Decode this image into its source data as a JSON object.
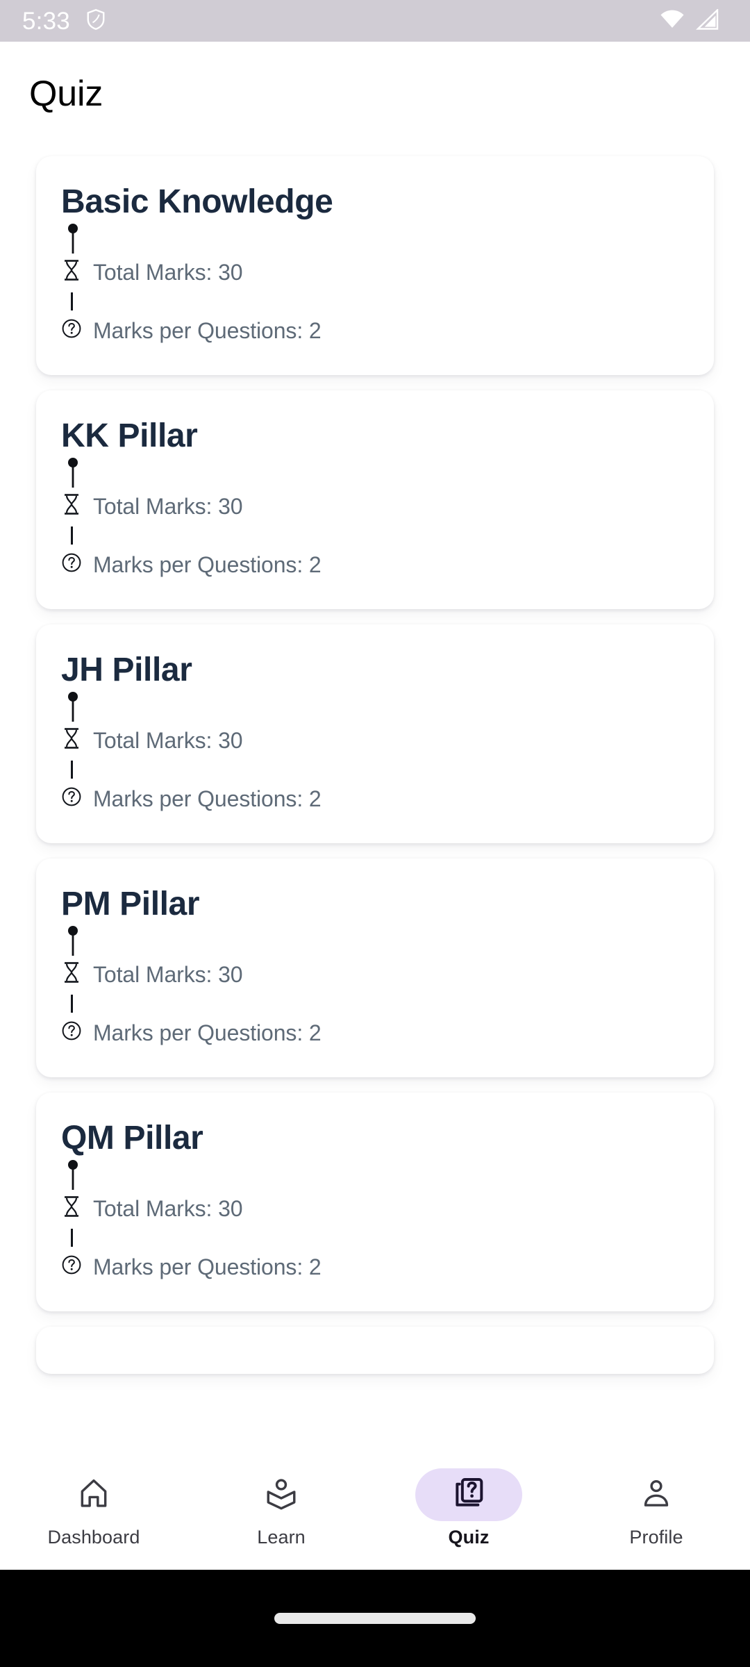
{
  "status_bar": {
    "clock": "5:33",
    "icons": [
      "shield-icon",
      "wifi-icon",
      "cellular-signal-icon"
    ],
    "background_color": "#d0ccd4",
    "foreground_color": "#ffffff"
  },
  "header": {
    "title": "Quiz"
  },
  "theme": {
    "card_background": "#ffffff",
    "card_title_color": "#1b2a3f",
    "meta_text_color": "#5e6a77",
    "active_nav_indicator": "#e7ddf8",
    "page_background": "#ffffff",
    "gesture_bar": "#000000"
  },
  "quiz_list": {
    "labels": {
      "total_marks_prefix": "Total Marks:",
      "marks_per_question_prefix": "Marks per Questions:"
    },
    "glyphs": {
      "pin": "•",
      "hourglass": "⧗",
      "question": "?"
    },
    "items": [
      {
        "title": "Basic Knowledge",
        "total_marks_text": "Total Marks: 30",
        "marks_per_question_text": "Marks per Questions: 2",
        "total_marks": 30,
        "marks_per_question": 2
      },
      {
        "title": "KK Pillar",
        "total_marks_text": "Total Marks: 30",
        "marks_per_question_text": "Marks per Questions: 2",
        "total_marks": 30,
        "marks_per_question": 2
      },
      {
        "title": "JH Pillar",
        "total_marks_text": "Total Marks: 30",
        "marks_per_question_text": "Marks per Questions: 2",
        "total_marks": 30,
        "marks_per_question": 2
      },
      {
        "title": "PM Pillar",
        "total_marks_text": "Total Marks: 30",
        "marks_per_question_text": "Marks per Questions: 2",
        "total_marks": 30,
        "marks_per_question": 2
      },
      {
        "title": "QM Pillar",
        "total_marks_text": "Total Marks: 30",
        "marks_per_question_text": "Marks per Questions: 2",
        "total_marks": 30,
        "marks_per_question": 2
      }
    ]
  },
  "bottom_nav": {
    "selected": "Quiz",
    "items": [
      {
        "label": "Dashboard",
        "icon": "home-icon",
        "active": false
      },
      {
        "label": "Learn",
        "icon": "school-icon",
        "active": false
      },
      {
        "label": "Quiz",
        "icon": "quiz-icon",
        "active": true
      },
      {
        "label": "Profile",
        "icon": "person-icon",
        "active": false
      }
    ]
  }
}
